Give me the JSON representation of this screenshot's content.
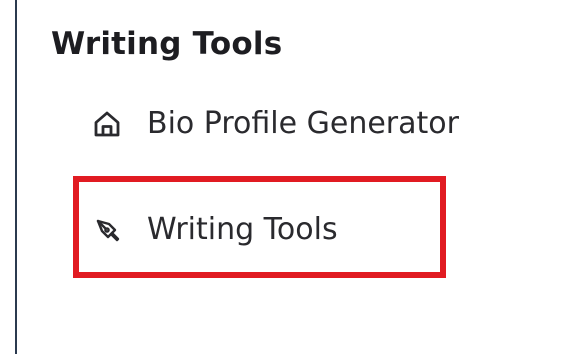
{
  "section": {
    "title": "Writing Tools"
  },
  "nav": {
    "items": [
      {
        "label": "Bio Profile Generator",
        "icon": "home-icon"
      },
      {
        "label": "Writing Tools",
        "icon": "pen-nib-icon",
        "highlighted": true
      }
    ]
  },
  "colors": {
    "highlight": "#e11b22",
    "panel_border": "#2b3a4f",
    "text": "#1d1d21"
  }
}
